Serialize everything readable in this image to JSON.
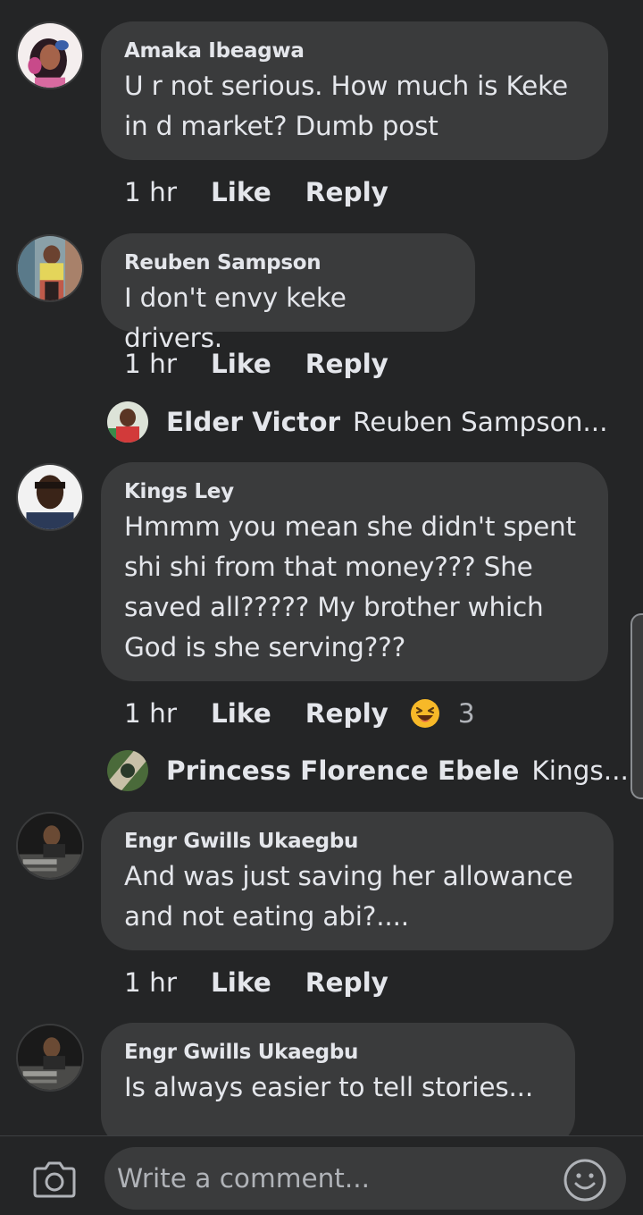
{
  "comments": [
    {
      "author": "Amaka Ibeagwa",
      "lines": [
        "U r not serious. How much is Keke",
        "in d market? Dumb post"
      ],
      "time": "1 hr",
      "like": "Like",
      "reply": "Reply"
    },
    {
      "author": "Reuben Sampson",
      "lines": [
        "I don't envy keke drivers."
      ],
      "time": "1 hr",
      "like": "Like",
      "reply": "Reply",
      "reply_preview": {
        "name": "Elder Victor",
        "text": "Reuben Sampson..."
      }
    },
    {
      "author": "Kings Ley",
      "lines": [
        "Hmmm you mean she didn't spent",
        "shi shi from that money??? She",
        "saved all????? My brother which",
        "God is she serving???"
      ],
      "time": "1 hr",
      "like": "Like",
      "reply": "Reply",
      "reaction": {
        "icon": "haha-emoji-icon",
        "count": "3"
      },
      "reply_preview": {
        "name": "Princess Florence Ebele",
        "text": "Kings..."
      }
    },
    {
      "author": "Engr Gwills Ukaegbu",
      "lines": [
        "And was just saving her allowance",
        "and not eating abi?...."
      ],
      "time": "1 hr",
      "like": "Like",
      "reply": "Reply"
    },
    {
      "author": "Engr Gwills Ukaegbu",
      "lines": [
        "Is always easier to tell stories..."
      ]
    }
  ],
  "composer": {
    "placeholder": "Write a comment...",
    "camera_icon": "camera-icon",
    "emoji_icon": "smiley-icon"
  },
  "colors": {
    "background": "#242526",
    "bubble": "#3a3b3c",
    "text": "#e4e6eb",
    "reaction": "#f7b928"
  }
}
